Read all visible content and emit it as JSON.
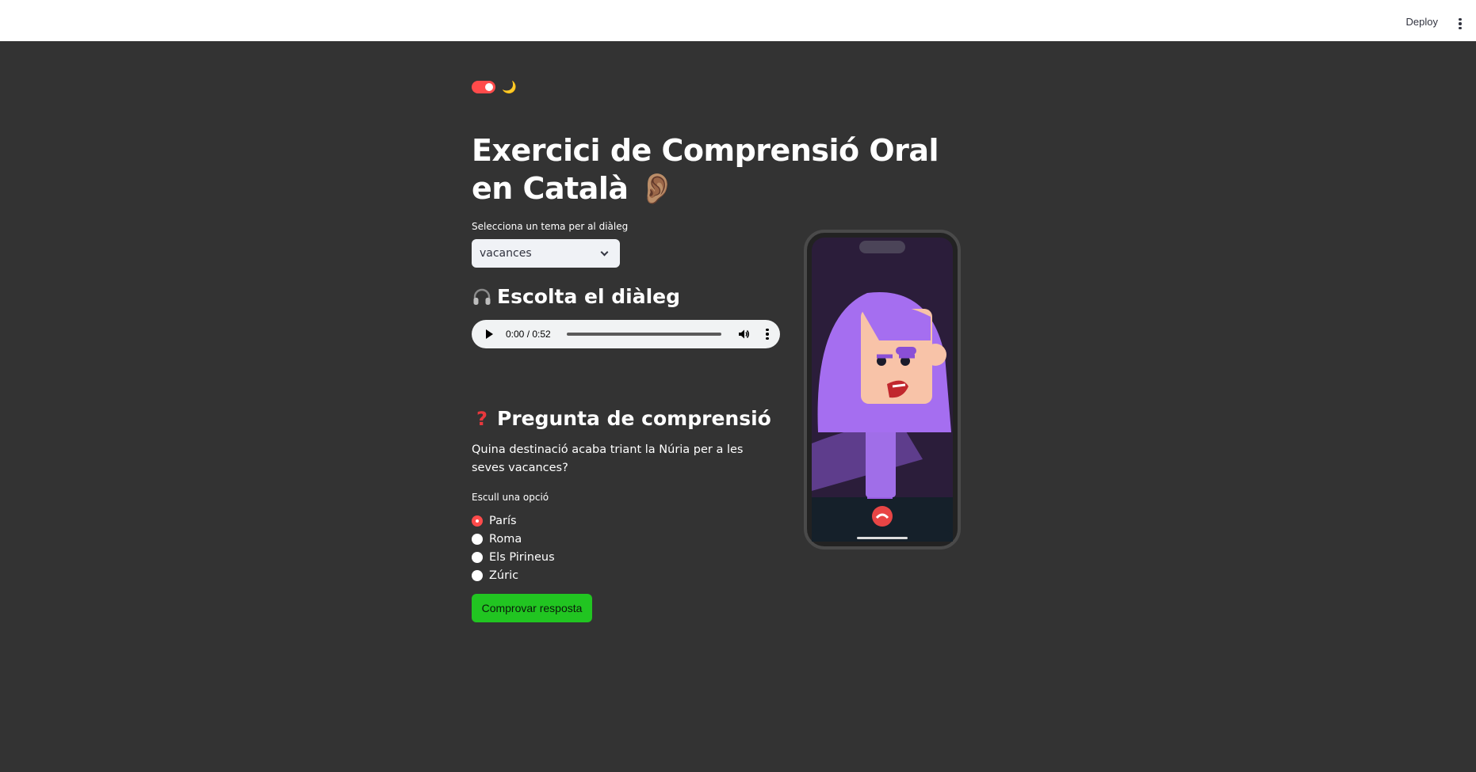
{
  "topbar": {
    "deploy_label": "Deploy"
  },
  "theme": {
    "toggle_on": true,
    "moon_glyph": "🌙",
    "accent_color": "#ff4b4b"
  },
  "page": {
    "title": "Exercici de Comprensió Oral en Català 👂🏽"
  },
  "topic_select": {
    "label": "Selecciona un tema per al diàleg",
    "value": "vacances"
  },
  "audio_section": {
    "heading": "Escolta el diàleg",
    "icon": "headphones-icon",
    "time": "0:00 / 0:52"
  },
  "question_section": {
    "heading": "Pregunta de comprensió",
    "icon": "question-mark-icon",
    "question": "Quina destinació acaba triant la Núria per a les seves vacances?"
  },
  "options": {
    "label": "Escull una opció",
    "items": [
      {
        "label": "París",
        "selected": true
      },
      {
        "label": "Roma",
        "selected": false
      },
      {
        "label": "Els Pirineus",
        "selected": false
      },
      {
        "label": "Zúric",
        "selected": false
      }
    ]
  },
  "submit": {
    "label": "Comprovar resposta",
    "color": "#21c521"
  }
}
